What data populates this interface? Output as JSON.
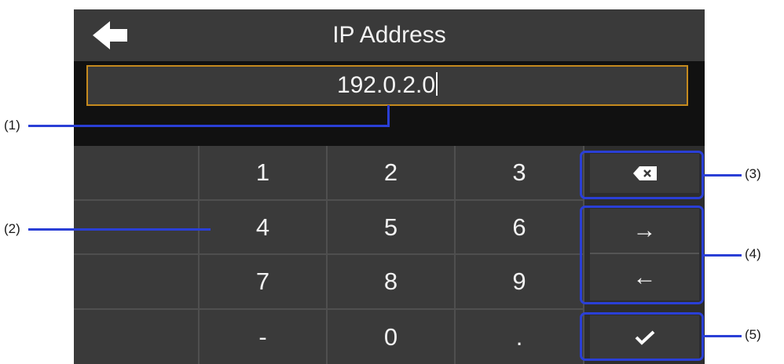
{
  "header": {
    "title": "IP Address",
    "back_icon": "arrow-left-icon"
  },
  "ip_field": {
    "value": "192.0.2.0"
  },
  "keypad": {
    "rows": [
      [
        "",
        "1",
        "2",
        "3"
      ],
      [
        "",
        "4",
        "5",
        "6"
      ],
      [
        "",
        "7",
        "8",
        "9"
      ],
      [
        "",
        "-",
        "0",
        "."
      ]
    ]
  },
  "side_keys": {
    "backspace_icon": "backspace-icon",
    "right_arrow": "→",
    "left_arrow": "←",
    "confirm_icon": "checkmark-icon"
  },
  "callouts": {
    "c1": "(1)",
    "c2": "(2)",
    "c3": "(3)",
    "c4": "(4)",
    "c5": "(5)"
  },
  "colors": {
    "screen_bg": "#111111",
    "panel_bg": "#3a3a3a",
    "field_border": "#c58a1e",
    "callout": "#2a3fd6"
  }
}
